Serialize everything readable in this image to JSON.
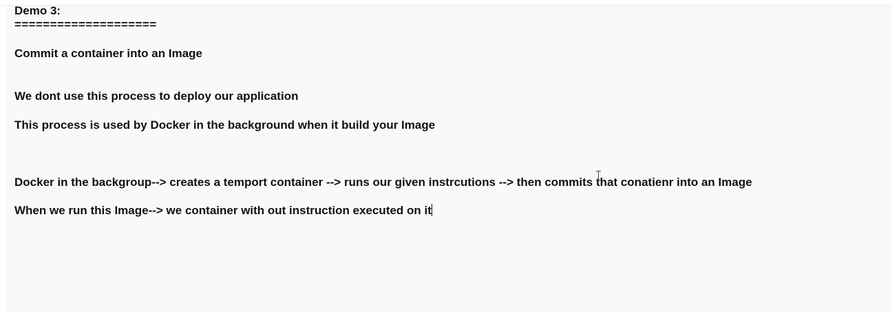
{
  "document": {
    "heading": "Demo 3:",
    "rule": "====================",
    "lines": [
      "Commit a container into an Image",
      "We dont use this process to deploy our application",
      "This process is used by Docker in the background when it build your Image",
      "Docker in the backgroup--> creates a temport container --> runs our given instrcutions --> then commits that conatienr into an Image",
      "When we run this Image--> we container with out instruction executed on it"
    ]
  },
  "icons": {
    "mouse_cursor": "text-ibeam-cursor-icon",
    "caret": "text-caret"
  },
  "colors": {
    "text": "#111111",
    "background": "#f9f9f9"
  }
}
